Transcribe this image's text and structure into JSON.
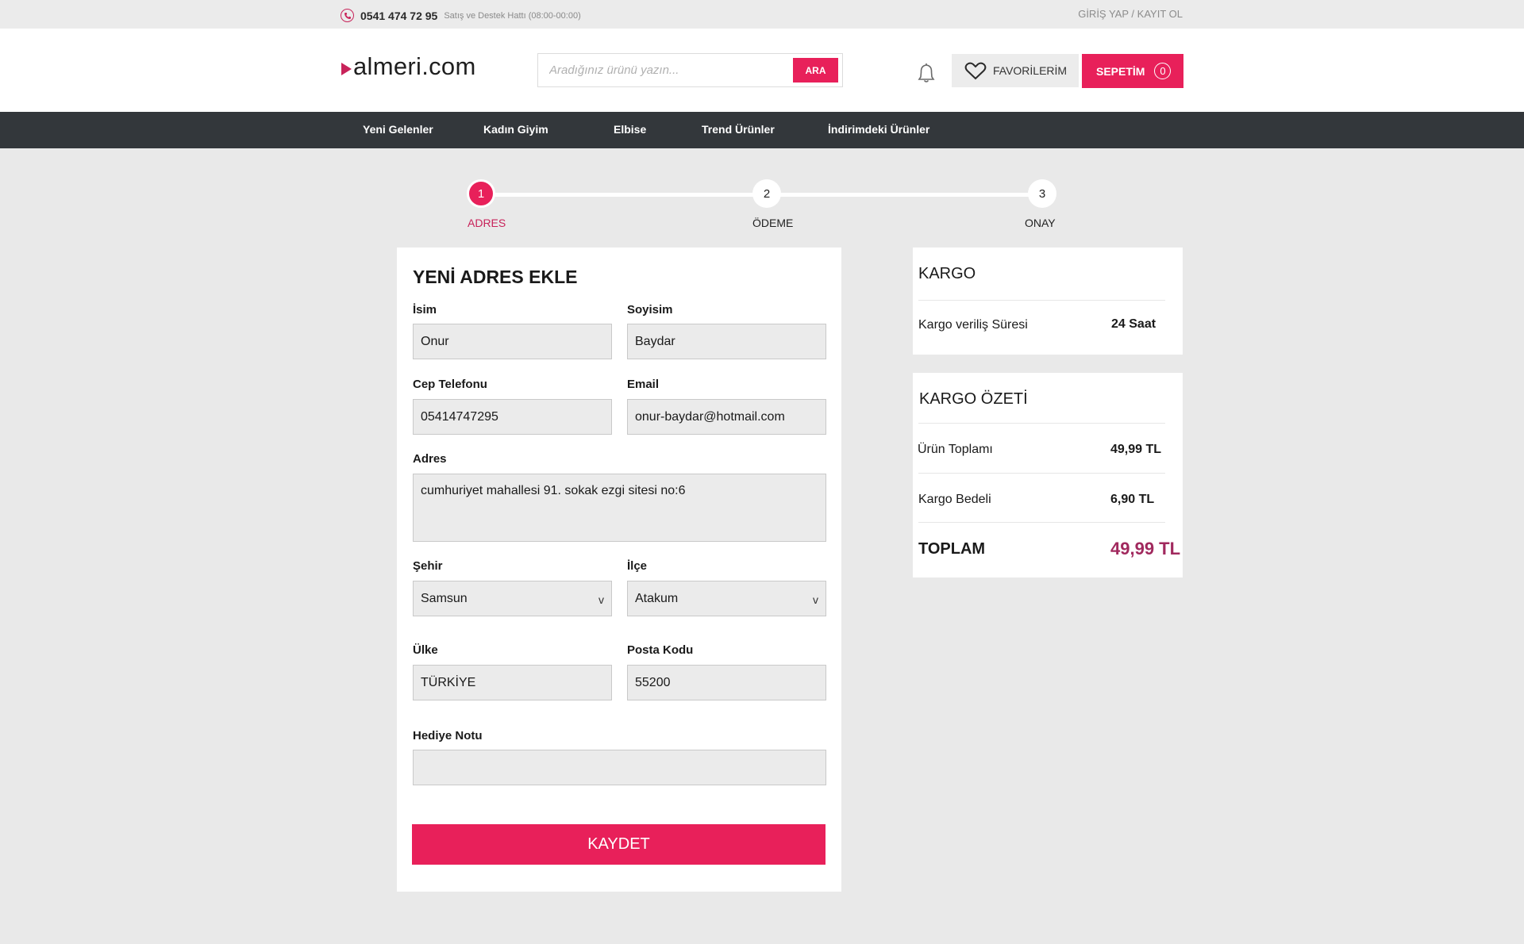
{
  "topbar": {
    "phone_number": "0541 474 72 95",
    "phone_note": "Satış ve Destek Hattı (08:00-00:00)",
    "login": "GİRİŞ YAP",
    "separator": "/",
    "register": "KAYIT OL"
  },
  "header": {
    "logo": "almeri.com",
    "search_placeholder": "Aradığınız ürünü yazın...",
    "search_button": "ARA",
    "favorites_label": "FAVORİLERİM",
    "cart_label": "SEPETİM",
    "cart_count": "0"
  },
  "nav": {
    "items": [
      "Yeni Gelenler",
      "Kadın Giyim",
      "Elbise",
      "Trend Ürünler",
      "İndirimdeki Ürünler"
    ]
  },
  "steps": [
    {
      "number": "1",
      "label": "ADRES"
    },
    {
      "number": "2",
      "label": "ÖDEME"
    },
    {
      "number": "3",
      "label": "ONAY"
    }
  ],
  "form": {
    "title": "YENİ ADRES EKLE",
    "first_name_label": "İsim",
    "first_name_value": "Onur",
    "last_name_label": "Soyisim",
    "last_name_value": "Baydar",
    "phone_label": "Cep Telefonu",
    "phone_value": "05414747295",
    "email_label": "Email",
    "email_value": "onur-baydar@hotmail.com",
    "address_label": "Adres",
    "address_value": "cumhuriyet mahallesi 91. sokak ezgi sitesi no:6",
    "city_label": "Şehir",
    "city_value": "Samsun",
    "district_label": "İlçe",
    "district_value": "Atakum",
    "country_label": "Ülke",
    "country_value": "TÜRKİYE",
    "postal_label": "Posta Kodu",
    "postal_value": "55200",
    "gift_label": "Hediye Notu",
    "gift_value": "",
    "select_chevron": "v",
    "save_button": "KAYDET"
  },
  "shipping": {
    "title": "KARGO",
    "delivery_label": "Kargo veriliş Süresi",
    "delivery_value": "24 Saat"
  },
  "summary": {
    "title": "KARGO ÖZETİ",
    "subtotal_label": "Ürün Toplamı",
    "subtotal_value": "49,99 TL",
    "shipping_label": "Kargo Bedeli",
    "shipping_value": "6,90 TL",
    "total_label": "TOPLAM",
    "total_value": "49,99 TL"
  },
  "colors": {
    "accent": "#e8205a",
    "nav_bg": "#33373b",
    "total_text": "#a1295e"
  }
}
